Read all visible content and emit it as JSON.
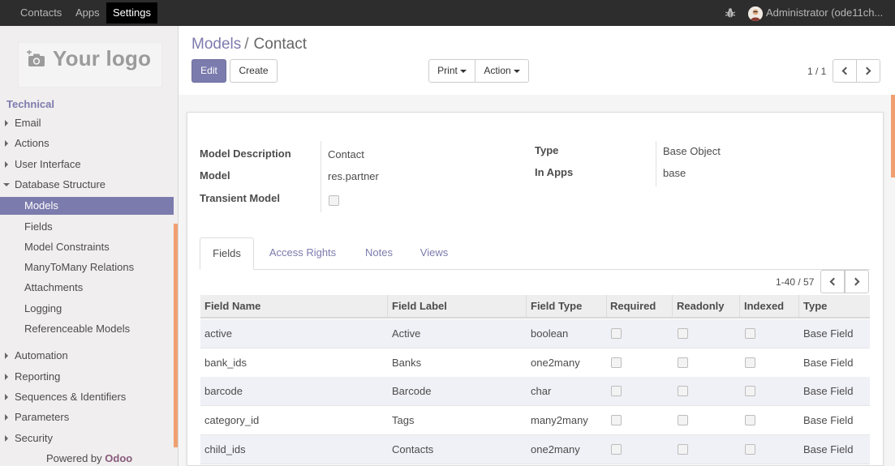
{
  "topbar": {
    "apps": [
      {
        "label": "Contacts",
        "active": false
      },
      {
        "label": "Apps",
        "active": false
      },
      {
        "label": "Settings",
        "active": true
      }
    ],
    "user_label": "Administrator (ode11ch..."
  },
  "sidebar": {
    "logo_text": "Your logo",
    "section_title": "Technical",
    "items": [
      {
        "label": "Email",
        "level": 1
      },
      {
        "label": "Actions",
        "level": 1
      },
      {
        "label": "User Interface",
        "level": 1
      },
      {
        "label": "Database Structure",
        "level": 1
      },
      {
        "label": "Models",
        "level": 2,
        "active": true
      },
      {
        "label": "Fields",
        "level": 2
      },
      {
        "label": "Model Constraints",
        "level": 2
      },
      {
        "label": "ManyToMany Relations",
        "level": 2
      },
      {
        "label": "Attachments",
        "level": 2
      },
      {
        "label": "Logging",
        "level": 2
      },
      {
        "label": "Referenceable Models",
        "level": 2
      },
      {
        "label": "Automation",
        "level": 1
      },
      {
        "label": "Reporting",
        "level": 1
      },
      {
        "label": "Sequences & Identifiers",
        "level": 1
      },
      {
        "label": "Parameters",
        "level": 1
      },
      {
        "label": "Security",
        "level": 1
      }
    ],
    "powered_prefix": "Powered by",
    "powered_brand": "Odoo"
  },
  "breadcrumb": {
    "parent": "Models",
    "separator": "/",
    "current": "Contact"
  },
  "toolbar": {
    "edit_label": "Edit",
    "create_label": "Create",
    "print_label": "Print",
    "action_label": "Action",
    "pager": "1 / 1"
  },
  "form": {
    "model_description_label": "Model Description",
    "model_description_value": "Contact",
    "model_label": "Model",
    "model_value": "res.partner",
    "transient_label": "Transient Model",
    "type_label": "Type",
    "type_value": "Base Object",
    "in_apps_label": "In Apps",
    "in_apps_value": "base"
  },
  "tabs": [
    "Fields",
    "Access Rights",
    "Notes",
    "Views"
  ],
  "table": {
    "pager": "1-40 / 57",
    "columns": [
      "Field Name",
      "Field Label",
      "Field Type",
      "Required",
      "Readonly",
      "Indexed",
      "Type"
    ],
    "rows": [
      {
        "name": "active",
        "label": "Active",
        "ftype": "boolean",
        "type": "Base Field"
      },
      {
        "name": "bank_ids",
        "label": "Banks",
        "ftype": "one2many",
        "type": "Base Field"
      },
      {
        "name": "barcode",
        "label": "Barcode",
        "ftype": "char",
        "type": "Base Field"
      },
      {
        "name": "category_id",
        "label": "Tags",
        "ftype": "many2many",
        "type": "Base Field"
      },
      {
        "name": "child_ids",
        "label": "Contacts",
        "ftype": "one2many",
        "type": "Base Field"
      }
    ]
  },
  "colors": {
    "accent": "#7c7bad",
    "navbar": "#2d2d2d",
    "scroll_accent": "#f0a070",
    "brand": "#875a7b"
  },
  "icons": {
    "bug": "bug-icon",
    "avatar": "user-avatar",
    "camera": "camera-plus-icon"
  }
}
